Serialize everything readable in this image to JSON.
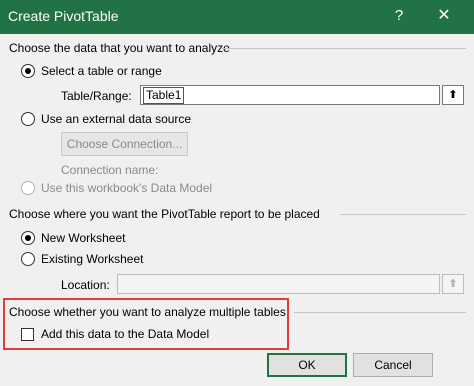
{
  "window": {
    "title": "Create PivotTable",
    "help_icon": "?",
    "close_icon": "✕"
  },
  "data_source": {
    "heading": "Choose the data that you want to analyze",
    "select_table_label": "Select a table or range",
    "table_range_label": "Table/Range:",
    "table_range_value": "Table1",
    "external_source_label": "Use an external data source",
    "choose_connection_button": "Choose Connection...",
    "connection_name_label": "Connection name:",
    "data_model_label": "Use this workbook's Data Model"
  },
  "placement": {
    "heading": "Choose where you want the PivotTable report to be placed",
    "new_worksheet_label": "New Worksheet",
    "existing_worksheet_label": "Existing Worksheet",
    "location_label": "Location:",
    "location_value": ""
  },
  "multiple_tables": {
    "heading": "Choose whether you want to analyze multiple tables",
    "add_to_data_model_label": "Add this data to the Data Model",
    "add_to_data_model_checked": false
  },
  "footer": {
    "ok_label": "OK",
    "cancel_label": "Cancel"
  },
  "colors": {
    "titlebar": "#217346",
    "highlight": "#e23b3b"
  },
  "icons": {
    "collapse_dialog": "collapse-dialog-icon"
  }
}
